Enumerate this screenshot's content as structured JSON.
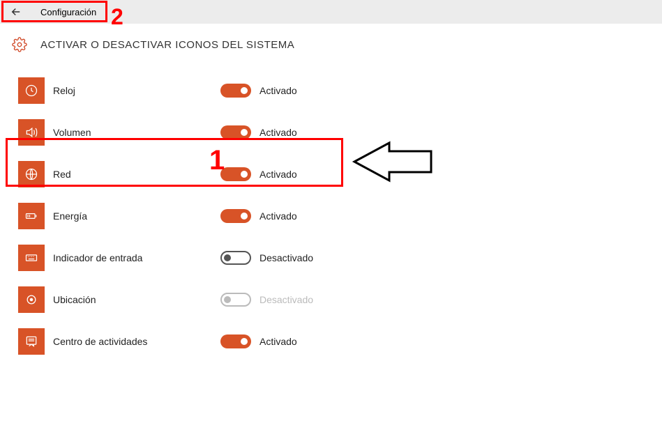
{
  "header": {
    "title": "Configuración"
  },
  "page": {
    "title": "ACTIVAR O DESACTIVAR ICONOS DEL SISTEMA"
  },
  "labels": {
    "on": "Activado",
    "off": "Desactivado"
  },
  "items": [
    {
      "label": "Reloj",
      "state": "on",
      "enabled": true,
      "icon": "clock-icon"
    },
    {
      "label": "Volumen",
      "state": "on",
      "enabled": true,
      "icon": "volume-icon"
    },
    {
      "label": "Red",
      "state": "on",
      "enabled": true,
      "icon": "network-icon"
    },
    {
      "label": "Energía",
      "state": "on",
      "enabled": true,
      "icon": "battery-icon"
    },
    {
      "label": "Indicador de entrada",
      "state": "off",
      "enabled": true,
      "icon": "keyboard-icon"
    },
    {
      "label": "Ubicación",
      "state": "off",
      "enabled": false,
      "icon": "location-icon"
    },
    {
      "label": "Centro de actividades",
      "state": "on",
      "enabled": true,
      "icon": "action-center-icon"
    }
  ],
  "annotations": {
    "num1": "1",
    "num2": "2"
  },
  "colors": {
    "accent": "#d85327",
    "annotation": "#f00"
  }
}
